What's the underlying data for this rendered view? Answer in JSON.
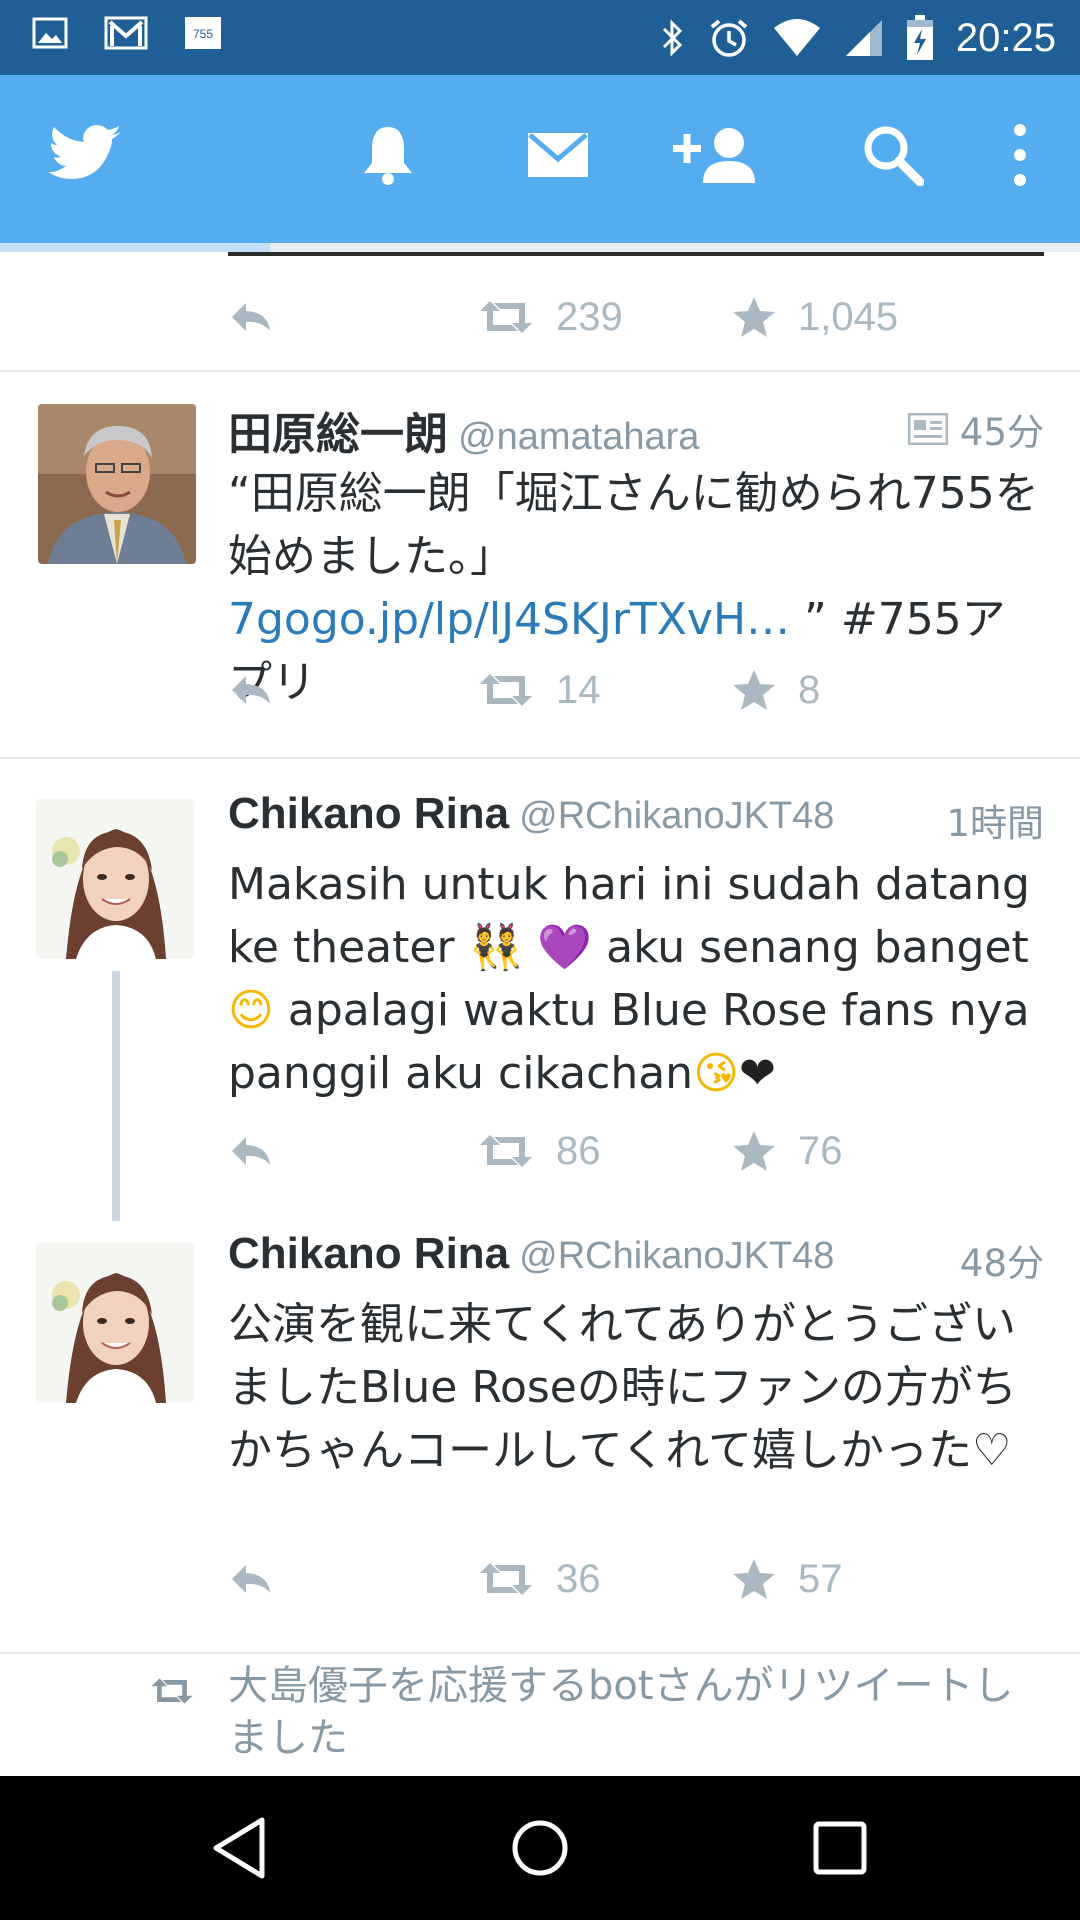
{
  "status_bar": {
    "time": "20:25",
    "left_icons": [
      "gallery-notification-icon",
      "gmail-notification-icon",
      "755-notification-icon"
    ],
    "right_icons": [
      "bluetooth-icon",
      "alarm-icon",
      "wifi-icon",
      "signal-icon",
      "battery-icon"
    ],
    "app_badge": "755"
  },
  "app_bar": {
    "tabs": [
      "home-bird-icon",
      "notifications-icon",
      "messages-icon",
      "add-user-icon",
      "search-icon",
      "overflow-menu-icon"
    ],
    "color": "#55acee"
  },
  "top_partial_tweet": {
    "retweets": "239",
    "favorites": "1,045"
  },
  "tweets": [
    {
      "name": "田原総一朗",
      "handle": "@namatahara",
      "time": "45分",
      "text_before": "“田原総一朗「堀江さんに勧められ755を始めました。」 ",
      "link": "7gogo.jp/lp/lJ4SKJrTXvH…",
      "text_after": " ” #755アプリ",
      "retweets": "14",
      "favorites": "8"
    },
    {
      "name": "Chikano Rina",
      "handle": "@RChikanoJKT48",
      "time": "1時間",
      "text_part1": "Makasih untuk hari ini sudah datang ke theater ",
      "text_part2": " aku senang banget",
      "text_part3": " apalagi waktu Blue Rose fans nya panggil aku cikachan",
      "emoji_1": "👯",
      "emoji_2": "💜",
      "emoji_3": "😊",
      "emoji_4": "😘",
      "emoji_5": "❤",
      "retweets": "86",
      "favorites": "76"
    },
    {
      "name": "Chikano Rina",
      "handle": "@RChikanoJKT48",
      "time": "48分",
      "text": "公演を観に来てくれてありがとうございましたBlue Roseの時にファンの方がちかちゃんコールしてくれて嬉しかった♡",
      "retweets": "36",
      "favorites": "57"
    }
  ],
  "retweet_note": {
    "text": "大島優子を応援するbotさんがリツイートしました"
  },
  "nav_bar": {
    "buttons": [
      "back-icon",
      "home-icon",
      "recents-icon"
    ]
  }
}
